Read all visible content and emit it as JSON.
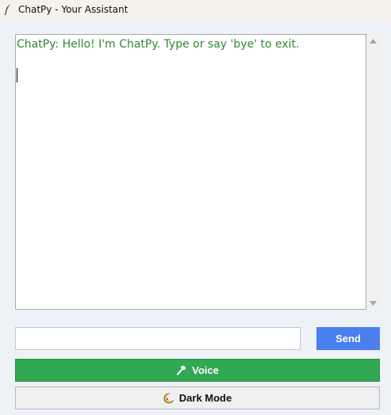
{
  "window": {
    "title": "ChatPy - Your Assistant",
    "icon": "feather-icon"
  },
  "chat": {
    "messages": [
      "ChatPy: Hello! I'm ChatPy. Type or say 'bye' to exit."
    ],
    "message_color": "#2e8b2e"
  },
  "input": {
    "value": "",
    "placeholder": ""
  },
  "buttons": {
    "send_label": "Send",
    "send_color": "#4a7ff0",
    "voice_label": "Voice",
    "voice_icon": "microphone-icon",
    "voice_color": "#31a852",
    "dark_mode_label": "Dark Mode",
    "dark_mode_icon": "moon-icon"
  }
}
